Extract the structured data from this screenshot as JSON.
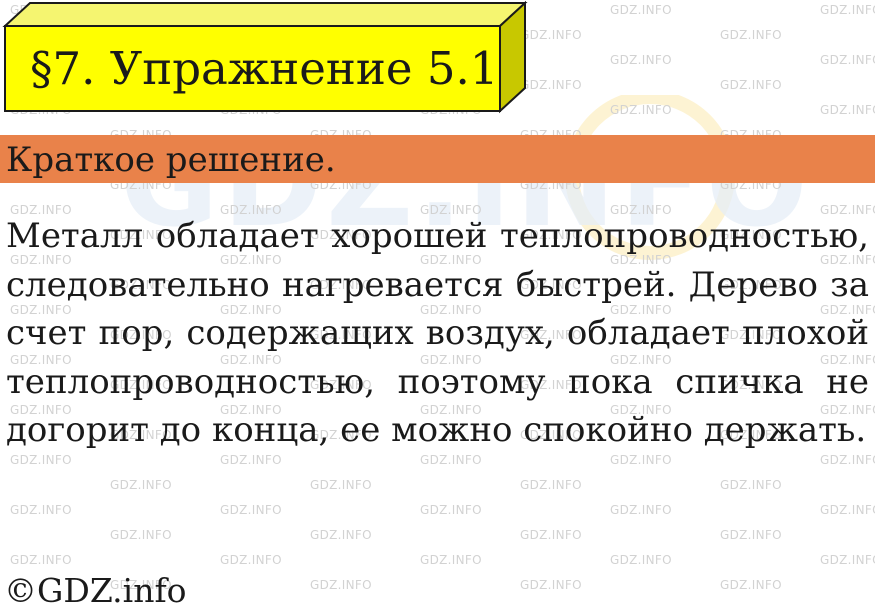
{
  "title": "§7. Упражнение 5.1",
  "section_label": "Краткое решение.",
  "body": "Металл обладает хорошей теплопроводностью, следовательно нагревается быстрей. Дерево за счет пор, содержащих воздух, обладает плохой теплопроводностью, поэтому пока спичка не догорит до конца, ее можно спокойно держать.",
  "footer": "©GDZ.info",
  "watermark": {
    "text": "GDZ.INFO",
    "logo_text": "GDZ.INFO"
  },
  "colors": {
    "title_box_front": "#ffff00",
    "title_box_top": "#f5f570",
    "title_box_side": "#c8c800",
    "section_bar": "#e9824a",
    "watermark": "#d2d2d2"
  }
}
